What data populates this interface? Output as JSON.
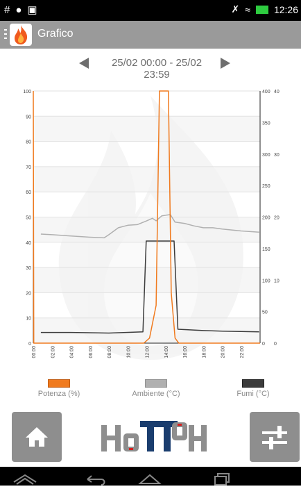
{
  "status": {
    "left_icons": [
      "hash-icon",
      "cat-icon",
      "image-icon"
    ],
    "right_icons": [
      "mute-icon",
      "wifi-icon",
      "battery-icon"
    ],
    "time": "12:26"
  },
  "appbar": {
    "title": "Grafico"
  },
  "range": {
    "label": "25/02 00:00 - 25/02 23:59"
  },
  "legend": [
    {
      "label": "Potenza (%)",
      "color": "#f07a1e"
    },
    {
      "label": "Ambiente (°C)",
      "color": "#b0b0b0"
    },
    {
      "label": "Fumi (°C)",
      "color": "#3c3c3c"
    }
  ],
  "brand": {
    "name": "HoTToH"
  },
  "chart_data": {
    "type": "line",
    "x_labels": [
      "00:00",
      "02:00",
      "04:00",
      "06:00",
      "08:00",
      "10:00",
      "12:00",
      "14:00",
      "16:00",
      "18:00",
      "20:00",
      "22:00"
    ],
    "x_range_hours": [
      0,
      24
    ],
    "left_axis": {
      "ticks": [
        0,
        10,
        20,
        30,
        40,
        50,
        60,
        70,
        80,
        90,
        100
      ],
      "ylim": [
        0,
        100
      ]
    },
    "right_axis": {
      "ticks": [
        0,
        50,
        100,
        150,
        200,
        250,
        300,
        350,
        400
      ],
      "ylim": [
        0,
        400
      ]
    },
    "right_axis2": {
      "ticks": [
        0,
        10,
        20,
        30,
        40
      ],
      "ylim": [
        0,
        40
      ]
    },
    "series": [
      {
        "name": "Potenza (%)",
        "color": "#f07a1e",
        "axis": "left",
        "points": [
          [
            0,
            100
          ],
          [
            0.05,
            0
          ],
          [
            11.7,
            0
          ],
          [
            12.3,
            2
          ],
          [
            13,
            15
          ],
          [
            13.35,
            100
          ],
          [
            14.3,
            100
          ],
          [
            14.6,
            20
          ],
          [
            15,
            2
          ],
          [
            15.4,
            0
          ],
          [
            24,
            0
          ]
        ]
      },
      {
        "name": "Ambiente (°C)",
        "color": "#b0b0b0",
        "axis": "right2",
        "points": [
          [
            0.8,
            17.3
          ],
          [
            2,
            17.2
          ],
          [
            4,
            17.0
          ],
          [
            6,
            16.8
          ],
          [
            7.5,
            16.7
          ],
          [
            8,
            17.2
          ],
          [
            9,
            18.3
          ],
          [
            10,
            18.7
          ],
          [
            11,
            18.8
          ],
          [
            12,
            19.4
          ],
          [
            12.6,
            19.8
          ],
          [
            13,
            19.4
          ],
          [
            13.6,
            20.2
          ],
          [
            14.5,
            20.4
          ],
          [
            15,
            19.2
          ],
          [
            16,
            19.0
          ],
          [
            17,
            18.6
          ],
          [
            18,
            18.3
          ],
          [
            19,
            18.3
          ],
          [
            20,
            18.1
          ],
          [
            22,
            17.8
          ],
          [
            23.9,
            17.6
          ]
        ]
      },
      {
        "name": "Fumi (°C)",
        "color": "#3c3c3c",
        "axis": "right",
        "points": [
          [
            0.8,
            17
          ],
          [
            4,
            17
          ],
          [
            8,
            16
          ],
          [
            11.6,
            18
          ],
          [
            11.95,
            162
          ],
          [
            14.9,
            162
          ],
          [
            15.3,
            22
          ],
          [
            18,
            20
          ],
          [
            20,
            19
          ],
          [
            23.9,
            18
          ]
        ]
      }
    ]
  }
}
